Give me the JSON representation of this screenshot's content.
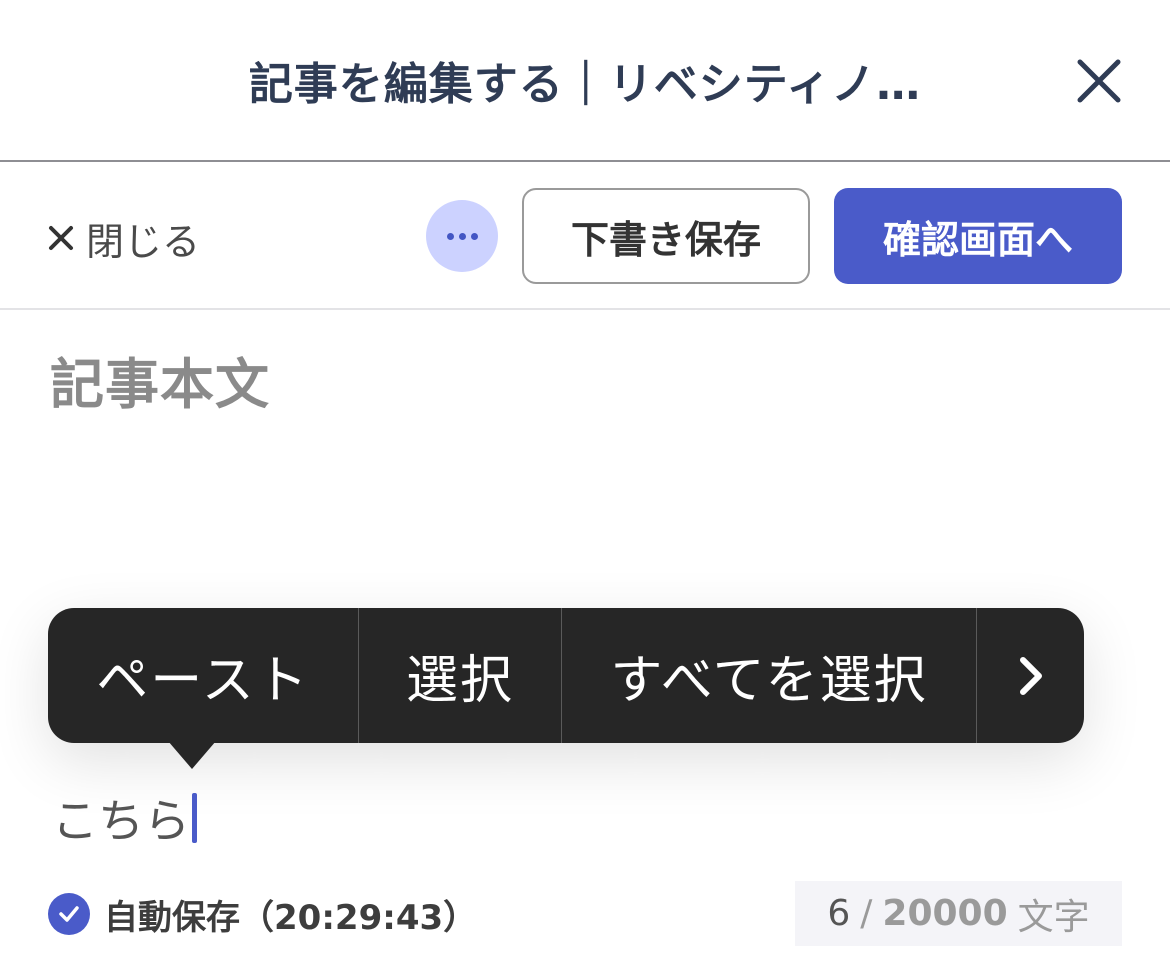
{
  "window": {
    "title": "記事を編集する｜リベシティノ…",
    "close_icon": "close-icon"
  },
  "toolbar": {
    "close_label": "閉じる",
    "more_icon": "more-horizontal-icon",
    "draft_label": "下書き保存",
    "confirm_label": "確認画面へ",
    "accent_color": "#4a5bc9"
  },
  "editor": {
    "heading": "記事本文",
    "text": "こちら"
  },
  "context_menu": {
    "items": [
      "ペースト",
      "選択",
      "すべてを選択"
    ],
    "next_icon": "chevron-right-icon"
  },
  "status": {
    "autosave_label": "自動保存（20:29:43）",
    "count_current": "6",
    "count_separator": "/",
    "count_max": "20000",
    "count_unit": "文字"
  }
}
